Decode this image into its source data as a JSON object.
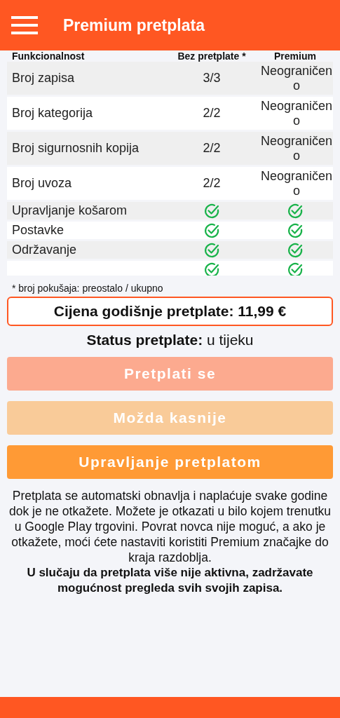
{
  "app_bar": {
    "title": "Premium pretplata"
  },
  "table": {
    "columns": [
      "Funkcionalnost",
      "Bez pretplate *",
      "Premium"
    ],
    "rows": [
      {
        "kind": "text",
        "name": "Broj zapisa",
        "free": "3/3",
        "premium": "Neograničeno"
      },
      {
        "kind": "text",
        "name": "Broj kategorija",
        "free": "2/2",
        "premium": "Neograničeno"
      },
      {
        "kind": "text",
        "name": "Broj sigurnosnih kopija",
        "free": "2/2",
        "premium": "Neograničeno"
      },
      {
        "kind": "text",
        "name": "Broj uvoza",
        "free": "2/2",
        "premium": "Neograničeno"
      },
      {
        "kind": "check",
        "name": "Upravljanje košarom",
        "free_checked": true,
        "premium_checked": true
      },
      {
        "kind": "check",
        "name": "Postavke",
        "free_checked": true,
        "premium_checked": true
      },
      {
        "kind": "check",
        "name": "Održavanje",
        "free_checked": true,
        "premium_checked": true
      },
      {
        "kind": "check",
        "free_checked": true,
        "premium_checked": true
      }
    ]
  },
  "footnote": "* broj pokušaja: preostalo / ukupno",
  "price": "Cijena godišnje pretplate: 11,99 €",
  "status": "**Status pretplate:** u tijeku",
  "buttons": [
    {
      "label": "Pretplati se",
      "kind": "primary",
      "disabled": true
    },
    {
      "label": "Možda kasnije",
      "kind": "secondary",
      "disabled": true
    },
    {
      "label": "Upravljanje pretplatom",
      "kind": "accent",
      "disabled": false
    }
  ],
  "info": "Pretplata se automatski obnavlja i naplaćuje svake godine dok je ne otkažete. Možete je otkazati u bilo kojem trenutku u Google Play trgovini. Povrat novca nije moguć, a ako je otkažete, moći ćete nastaviti koristiti Premium značajke do kraja razdoblja.",
  "note": "U slučaju da pretplata više nije aktivna, zadržavate mogućnost pregleda svih svojih zapisa."
}
